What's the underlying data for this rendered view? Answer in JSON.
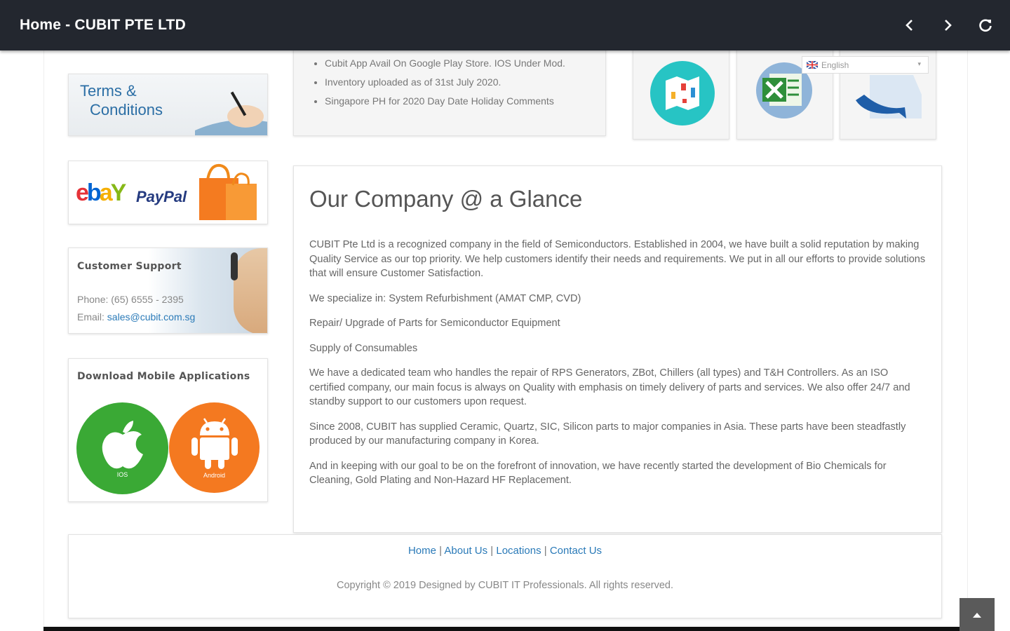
{
  "appbar": {
    "title": "Home - CUBIT PTE LTD",
    "back_icon": "chevron-left-icon",
    "forward_icon": "chevron-right-icon",
    "refresh_icon": "refresh-icon"
  },
  "sidebar": {
    "terms_line1": "Terms &",
    "terms_line2": "Conditions",
    "ebay": "ebY",
    "paypal": "PayPal",
    "support_heading": "Customer Support",
    "phone": "Phone: (65) 6555 - 2395",
    "email_label": "Email:",
    "email": "sales@cubit.com.sg",
    "download_heading": "Download Mobile Applications",
    "ios_label": "IOS",
    "android_label": "Android"
  },
  "news": {
    "items": [
      "Cubit App Avail On Google Play Store. IOS Under Mod.",
      "Inventory uploaded as of 31st July 2020.",
      "Singapore PH for 2020 Day Date Holiday Comments"
    ]
  },
  "language": {
    "selected": "English"
  },
  "main": {
    "title": "Our Company @ a Glance",
    "paragraphs": [
      "CUBIT Pte Ltd is a recognized company in the field of Semiconductors. Established in 2004, we have built a solid reputation by making Quality Service as our top priority. We help customers identify their needs and requirements. We put in all our efforts to provide solutions that will ensure Customer Satisfaction.",
      "We specialize in: System Refurbishment (AMAT CMP, CVD)",
      "Repair/ Upgrade of Parts for Semiconductor Equipment",
      "Supply of Consumables",
      "We have a dedicated team who handles the repair of RPS Generators, ZBot, Chillers (all types) and T&H Controllers. As an ISO certified company, our main focus is always on Quality with emphasis on timely delivery of parts and services. We also offer 24/7 and standby support to our customers upon request.",
      "Since 2008, CUBIT has supplied Ceramic, Quartz, SIC, Silicon parts to major companies in Asia. These parts have been steadfastly produced by our manufacturing company in Korea.",
      "And in keeping with our goal to be on the forefront of innovation, we have recently started the development of Bio Chemicals for Cleaning, Gold Plating and Non-Hazard HF Replacement."
    ]
  },
  "footer": {
    "links": [
      "Home",
      "About Us",
      "Locations",
      "Contact Us"
    ],
    "separator": "|",
    "copyright": "Copyright © 2019 Designed by CUBIT IT Professionals. All rights reserved."
  },
  "colors": {
    "appbar": "#23272f",
    "link": "#2a7ab8",
    "ios_green": "#3aa935",
    "android_orange": "#f47920"
  }
}
